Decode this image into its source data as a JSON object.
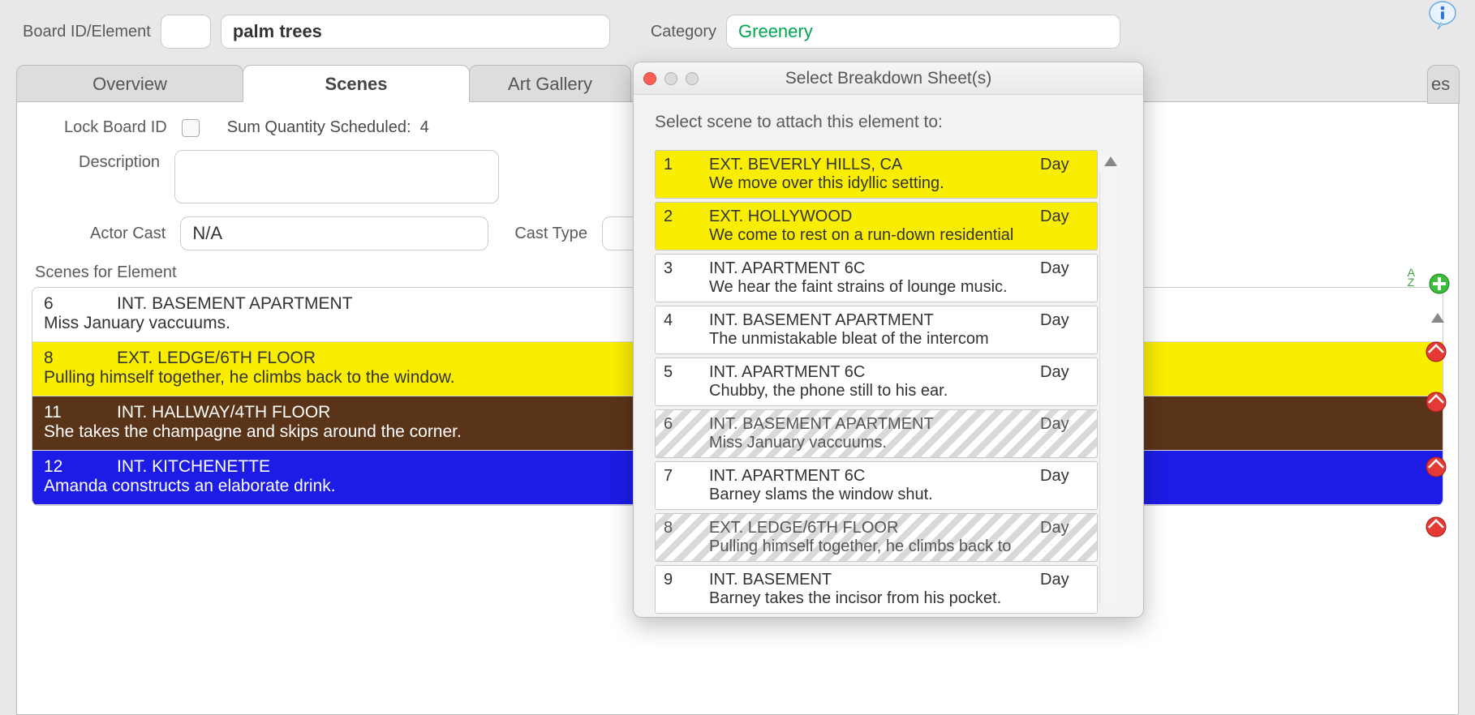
{
  "form": {
    "board_id_label": "Board ID/Element",
    "board_id_value": "",
    "element_value": "palm trees",
    "category_label": "Category",
    "category_value": "Greenery"
  },
  "tabs": {
    "overview": "Overview",
    "scenes": "Scenes",
    "art_gallery": "Art Gallery",
    "hidden_es": "es"
  },
  "scenes_panel": {
    "lock_board_id_label": "Lock Board ID",
    "sum_qty_label": "Sum Quantity Scheduled:",
    "sum_qty_value": "4",
    "description_label": "Description",
    "description_value": "",
    "actor_cast_label": "Actor Cast",
    "actor_cast_value": "N/A",
    "cast_type_label": "Cast Type",
    "scenes_for_element_label": "Scenes for Element",
    "items": [
      {
        "num": "6",
        "slug": "INT. BASEMENT APARTMENT",
        "desc": "Miss January vaccuums.",
        "color": "white"
      },
      {
        "num": "8",
        "slug": "EXT. LEDGE/6TH FLOOR",
        "desc": "Pulling himself together, he climbs back to the window.",
        "color": "yellow"
      },
      {
        "num": "11",
        "slug": "INT. HALLWAY/4TH FLOOR",
        "desc": "She takes the champagne and skips around the corner.",
        "color": "brown"
      },
      {
        "num": "12",
        "slug": "INT. KITCHENETTE",
        "desc": "Amanda constructs an elaborate drink.",
        "color": "blue"
      }
    ]
  },
  "sort_az": {
    "a": "A",
    "z": "Z"
  },
  "modal": {
    "title": "Select Breakdown Sheet(s)",
    "instruction": "Select scene to attach this element to:",
    "items": [
      {
        "num": "1",
        "slug": "EXT. BEVERLY HILLS, CA",
        "tod": "Day",
        "desc": "We move over this idyllic setting.",
        "style": "yellow"
      },
      {
        "num": "2",
        "slug": "EXT. HOLLYWOOD",
        "tod": "Day",
        "desc": "We come to rest on a run-down residential",
        "style": "yellow"
      },
      {
        "num": "3",
        "slug": "INT. APARTMENT 6C",
        "tod": "Day",
        "desc": "We hear the faint strains of lounge music.",
        "style": "white"
      },
      {
        "num": "4",
        "slug": "INT. BASEMENT APARTMENT",
        "tod": "Day",
        "desc": "The unmistakable bleat of the intercom",
        "style": "white"
      },
      {
        "num": "5",
        "slug": "INT. APARTMENT 6C",
        "tod": "Day",
        "desc": "Chubby, the phone still to his ear.",
        "style": "white"
      },
      {
        "num": "6",
        "slug": "INT. BASEMENT APARTMENT",
        "tod": "Day",
        "desc": "Miss January vaccuums.",
        "style": "hatched"
      },
      {
        "num": "7",
        "slug": "INT. APARTMENT 6C",
        "tod": "Day",
        "desc": "Barney slams the window shut.",
        "style": "white"
      },
      {
        "num": "8",
        "slug": "EXT. LEDGE/6TH FLOOR",
        "tod": "Day",
        "desc": "Pulling himself together, he climbs back to",
        "style": "hatched"
      },
      {
        "num": "9",
        "slug": "INT. BASEMENT",
        "tod": "Day",
        "desc": "Barney takes the incisor from his pocket.",
        "style": "white"
      }
    ]
  }
}
